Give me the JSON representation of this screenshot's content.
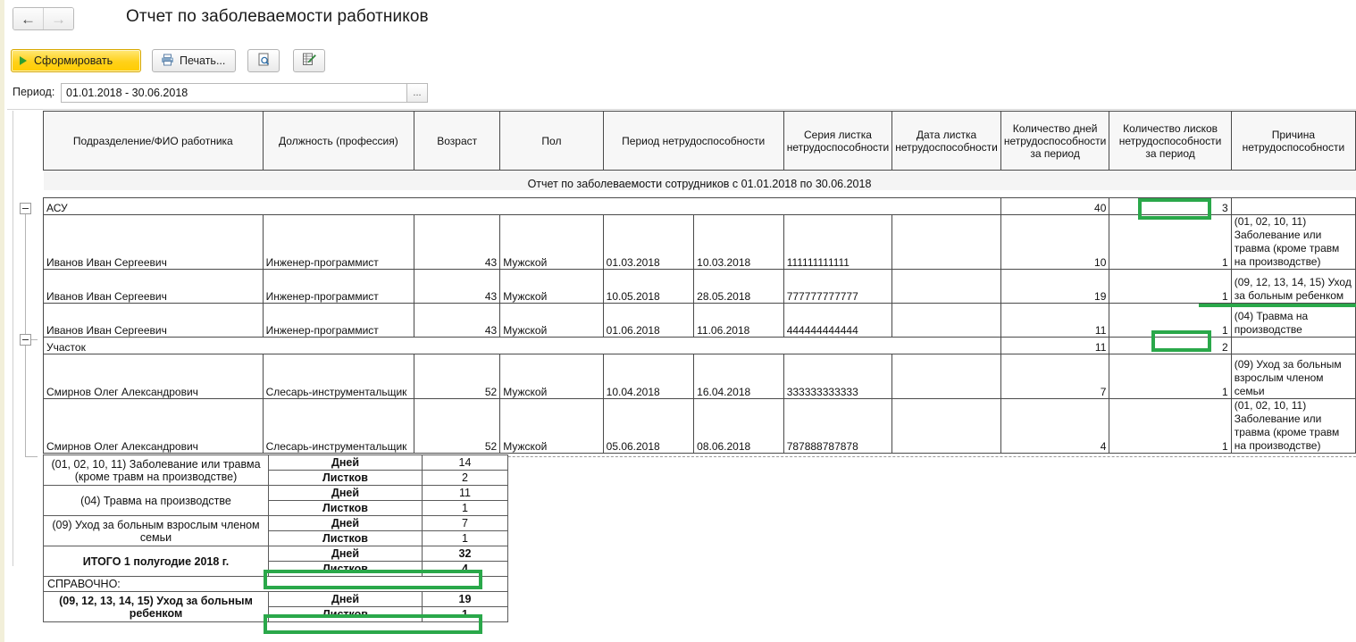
{
  "window": {
    "title": "Отчет по заболеваемости работников",
    "nav": {
      "back": "←",
      "forward": "→"
    }
  },
  "toolbar": {
    "generate_label": "Сформировать",
    "print_label": "Печать...",
    "preview_tooltip": "Предварительный просмотр",
    "editor_tooltip": "Редактировать"
  },
  "period": {
    "label": "Период:",
    "value": "01.01.2018 - 30.06.2018",
    "picker_label": "..."
  },
  "report": {
    "title": "Отчет по заболеваемости сотрудников с 01.01.2018 по 30.06.2018",
    "columns": [
      "Подразделение/ФИО работника",
      "Должность (профессия)",
      "Возраст",
      "Пол",
      "Период нетрудоспособности",
      "Серия листка нетрудоспособности",
      "Дата листка нетрудоспособности",
      "Количество дней нетрудоспособности за период",
      "Количество лисков нетрудоспособности за период",
      "Причина нетрудоспособности"
    ],
    "groups": [
      {
        "name": "АСУ",
        "days_total": "40",
        "sheets_total": "3",
        "rows": [
          {
            "fio": "Иванов Иван Сергеевич",
            "position": "Инженер-программист",
            "age": "43",
            "gender": "Мужской",
            "date_from": "01.03.2018",
            "date_to": "10.03.2018",
            "series": "111111111111",
            "sheet_date": "",
            "days": "10",
            "sheets": "1",
            "reason": "(01, 02, 10, 11) Заболевание или травма (кроме травм на производстве)"
          },
          {
            "fio": "Иванов Иван Сергеевич",
            "position": "Инженер-программист",
            "age": "43",
            "gender": "Мужской",
            "date_from": "10.05.2018",
            "date_to": "28.05.2018",
            "series": "777777777777",
            "sheet_date": "",
            "days": "19",
            "sheets": "1",
            "reason": "(09, 12, 13, 14, 15) Уход за больным ребенком"
          },
          {
            "fio": "Иванов Иван Сергеевич",
            "position": "Инженер-программист",
            "age": "43",
            "gender": "Мужской",
            "date_from": "01.06.2018",
            "date_to": "11.06.2018",
            "series": "444444444444",
            "sheet_date": "",
            "days": "11",
            "sheets": "1",
            "reason": "(04) Травма на производстве"
          }
        ]
      },
      {
        "name": "Участок",
        "days_total": "11",
        "sheets_total": "2",
        "rows": [
          {
            "fio": "Смирнов Олег Александрович",
            "position": "Слесарь-инструментальщик",
            "age": "52",
            "gender": "Мужской",
            "date_from": "10.04.2018",
            "date_to": "16.04.2018",
            "series": "333333333333",
            "sheet_date": "",
            "days": "7",
            "sheets": "1",
            "reason": "(09) Уход за больным взрослым членом семьи"
          },
          {
            "fio": "Смирнов Олег Александрович",
            "position": "Слесарь-инструментальщик",
            "age": "52",
            "gender": "Мужской",
            "date_from": "05.06.2018",
            "date_to": "08.06.2018",
            "series": "787888787878",
            "sheet_date": "",
            "days": "4",
            "sheets": "1",
            "reason": "(01, 02, 10, 11) Заболевание или травма (кроме травм на производстве)"
          }
        ]
      }
    ]
  },
  "summary": {
    "days_label": "Дней",
    "sheets_label": "Листков",
    "reference_label": "СПРАВОЧНО:",
    "rows": [
      {
        "label": "(01, 02, 10, 11) Заболевание или травма (кроме травм на производстве)",
        "days": "14",
        "sheets": "2"
      },
      {
        "label": "(04) Травма на производстве",
        "days": "11",
        "sheets": "1"
      },
      {
        "label": "(09) Уход за больным взрослым членом семьи",
        "days": "7",
        "sheets": "1"
      },
      {
        "label": "ИТОГО 1 полугодие 2018 г.",
        "days": "32",
        "sheets": "4"
      }
    ],
    "reference_row": {
      "label": "(09, 12, 13, 14, 15) Уход за больным ребенком",
      "days": "19",
      "sheets": "1"
    }
  },
  "highlights": {
    "color": "#2aa84a"
  }
}
